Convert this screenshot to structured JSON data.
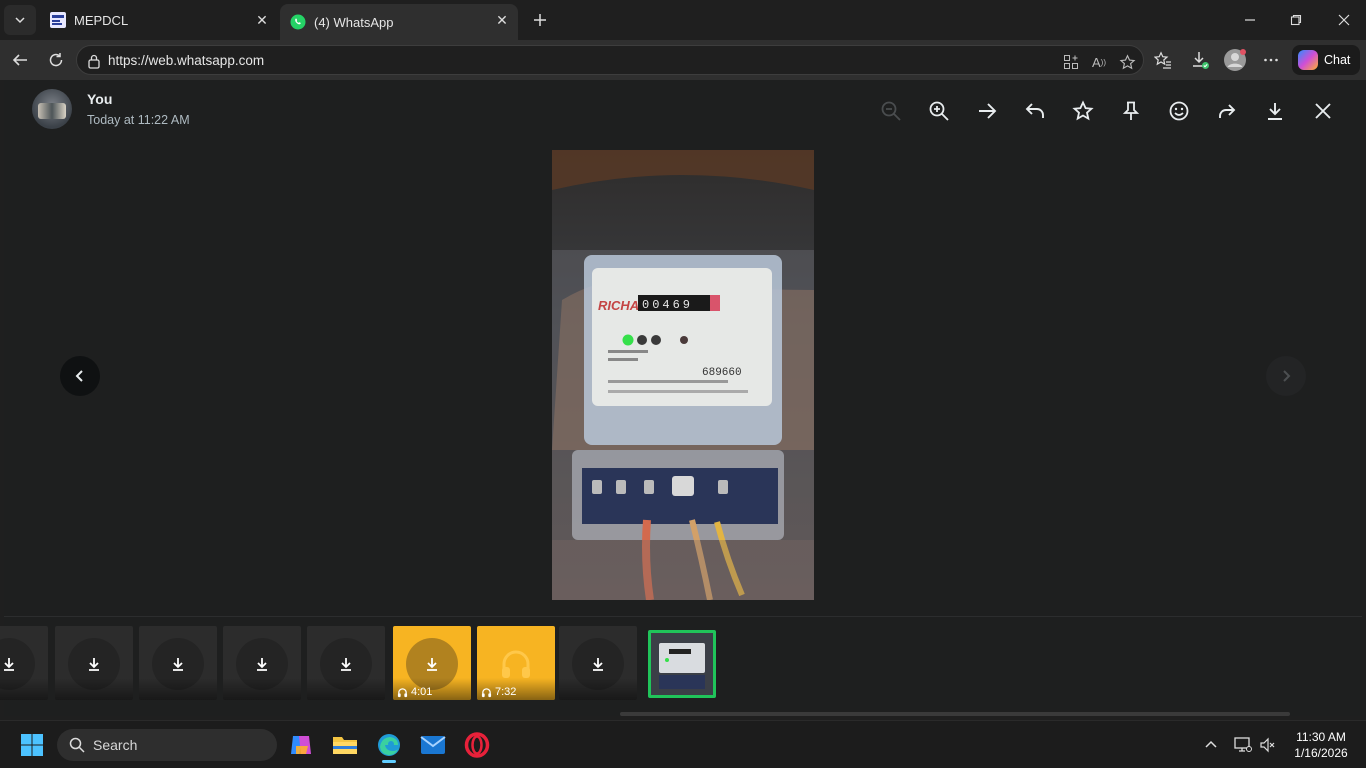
{
  "browser": {
    "tabs": [
      {
        "title": "MEPDCL"
      },
      {
        "title": "(4) WhatsApp"
      }
    ],
    "url": "https://web.whatsapp.com",
    "chat_button": "Chat"
  },
  "viewer": {
    "sender": "You",
    "timestamp": "Today at 11:22 AM",
    "toolbar": [
      "zoom-out",
      "zoom-in",
      "go-to-message",
      "reply",
      "star",
      "pin",
      "react",
      "forward",
      "download",
      "close"
    ],
    "thumbnails": [
      {
        "kind": "download"
      },
      {
        "kind": "download"
      },
      {
        "kind": "download"
      },
      {
        "kind": "download"
      },
      {
        "kind": "download"
      },
      {
        "kind": "audio",
        "duration": "4:01"
      },
      {
        "kind": "audio",
        "duration": "7:32"
      },
      {
        "kind": "download"
      },
      {
        "kind": "image-selected"
      }
    ]
  },
  "meter_photo": {
    "brand": "RICHA",
    "reading": "00469",
    "serial": "689660"
  },
  "taskbar": {
    "search_placeholder": "Search",
    "time": "11:30 AM",
    "date": "1/16/2026"
  },
  "colors": {
    "accent_green": "#20c45a",
    "audio_yellow": "#f7b422"
  }
}
